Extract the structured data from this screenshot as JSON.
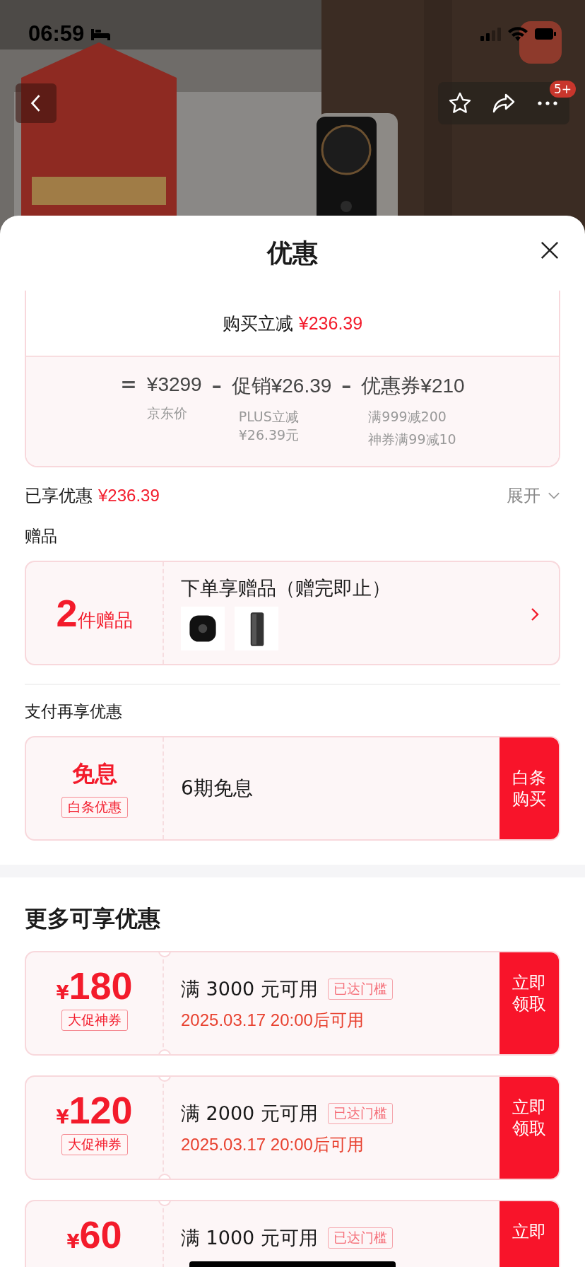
{
  "status_bar": {
    "time": "06:59"
  },
  "nav": {
    "badge": "5+"
  },
  "sheet": {
    "title": "优惠"
  },
  "summary": {
    "instant_label": "购买立减",
    "instant_amount": "¥236.39",
    "terms": [
      {
        "op": "=",
        "label": "¥3299",
        "notes": [
          "京东价"
        ]
      },
      {
        "op": "–",
        "label": "促销¥26.39",
        "notes": [
          "PLUS立减 ¥26.39元"
        ]
      },
      {
        "op": "–",
        "label": "优惠券¥210",
        "notes": [
          "满999减200",
          "神券满99减10"
        ]
      }
    ]
  },
  "enjoyed": {
    "label": "已享优惠",
    "amount": "¥236.39",
    "toggle": "展开",
    "expanded": false
  },
  "gifts": {
    "heading": "赠品",
    "count": "2",
    "unit": "件赠品",
    "title": "下单享赠品（赠完即止）"
  },
  "payment": {
    "heading": "支付再享优惠",
    "title": "免息",
    "tag": "白条优惠",
    "text": "6期免息",
    "button": "白条购买"
  },
  "more": {
    "heading": "更多可享优惠",
    "coupons": [
      {
        "currency": "¥",
        "amount": "180",
        "tag": "大促神券",
        "condition": "满 3000 元可用",
        "badge": "已达门槛",
        "date": "2025.03.17 20:00后可用",
        "button": "立即领取"
      },
      {
        "currency": "¥",
        "amount": "120",
        "tag": "大促神券",
        "condition": "满 2000 元可用",
        "badge": "已达门槛",
        "date": "2025.03.17 20:00后可用",
        "button": "立即领取"
      },
      {
        "currency": "¥",
        "amount": "60",
        "condition": "满 1000 元可用",
        "badge": "已达门槛",
        "button": "立即"
      }
    ]
  }
}
